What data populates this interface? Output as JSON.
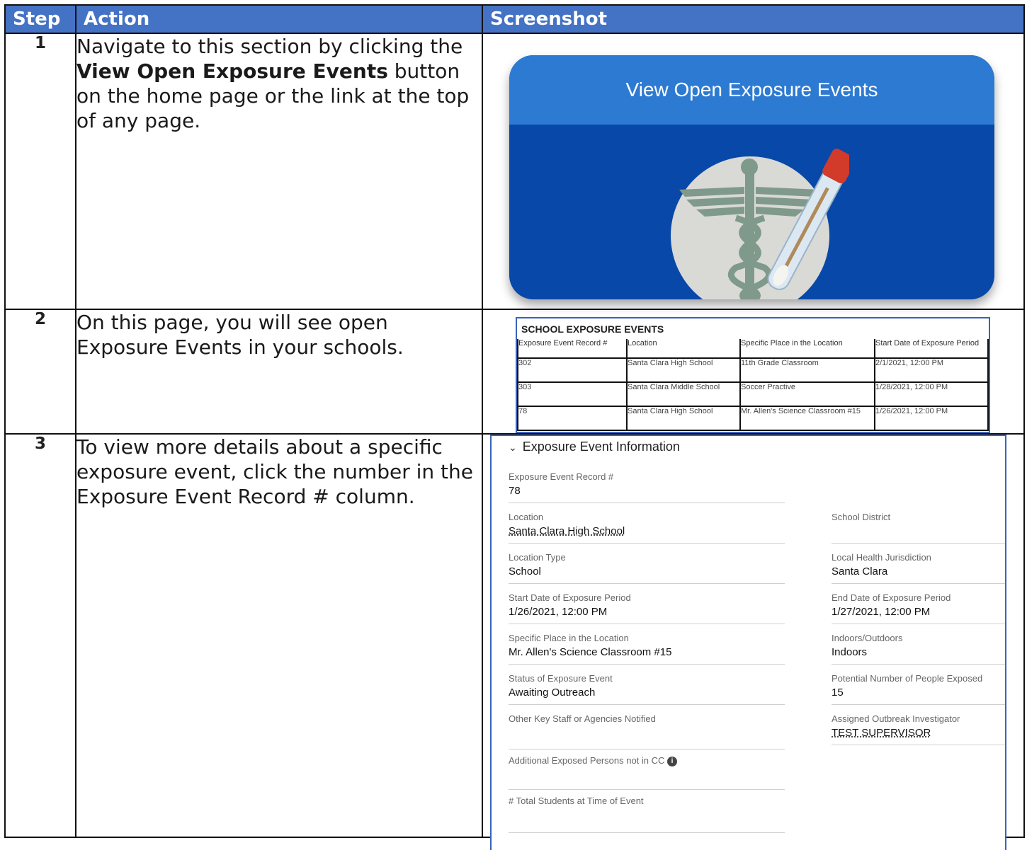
{
  "headers": {
    "step": "Step",
    "action": "Action",
    "screenshot": "Screenshot"
  },
  "rows": [
    {
      "num": "1",
      "text_pre": "Navigate to this section by clicking the ",
      "text_bold": "View Open Exposure Events",
      "text_post": " button on the home page or the link at the top of any page."
    },
    {
      "num": "2",
      "text": "On this page, you will see open Exposure Events in your schools."
    },
    {
      "num": "3",
      "text": "To view more details about a specific exposure event, click the number in the Exposure Event Record # column."
    }
  ],
  "button_card": {
    "label": "View Open Exposure Events",
    "icon": "caduceus-test-tube-icon"
  },
  "school_events": {
    "title": "SCHOOL EXPOSURE EVENTS",
    "columns": [
      "Exposure Event Record #",
      "Location",
      "Specific Place in the Location",
      "Start Date of Exposure Period"
    ],
    "rows": [
      [
        "302",
        "Santa Clara High School",
        "11th Grade Classroom",
        "2/1/2021, 12:00 PM"
      ],
      [
        "303",
        "Santa Clara Middle School",
        "Soccer Practive",
        "1/28/2021, 12:00 PM"
      ],
      [
        "78",
        "Santa Clara High School",
        "Mr. Allen's Science Classroom #15",
        "1/26/2021, 12:00 PM"
      ]
    ]
  },
  "details": {
    "title": "Exposure Event Information",
    "fields": {
      "record": {
        "label": "Exposure Event Record #",
        "value": "78"
      },
      "location": {
        "label": "Location",
        "value": "Santa Clara High School"
      },
      "district": {
        "label": "School District",
        "value": ""
      },
      "location_type": {
        "label": "Location Type",
        "value": "School"
      },
      "lhj": {
        "label": "Local Health Jurisdiction",
        "value": "Santa Clara"
      },
      "start": {
        "label": "Start Date of Exposure Period",
        "value": "1/26/2021, 12:00 PM"
      },
      "end": {
        "label": "End Date of Exposure Period",
        "value": "1/27/2021, 12:00 PM"
      },
      "place": {
        "label": "Specific Place in the Location",
        "value": "Mr. Allen's Science Classroom #15"
      },
      "indoors": {
        "label": "Indoors/Outdoors",
        "value": "Indoors"
      },
      "status": {
        "label": "Status of Exposure Event",
        "value": "Awaiting Outreach"
      },
      "potential": {
        "label": "Potential Number of People Exposed",
        "value": "15"
      },
      "other_staff": {
        "label": "Other Key Staff or Agencies Notified",
        "value": ""
      },
      "investigator": {
        "label": "Assigned Outbreak Investigator",
        "value": "TEST SUPERVISOR"
      },
      "additional": {
        "label": "Additional Exposed Persons not in CC",
        "value": ""
      },
      "total_students": {
        "label": "# Total Students at Time of Event",
        "value": ""
      }
    }
  }
}
